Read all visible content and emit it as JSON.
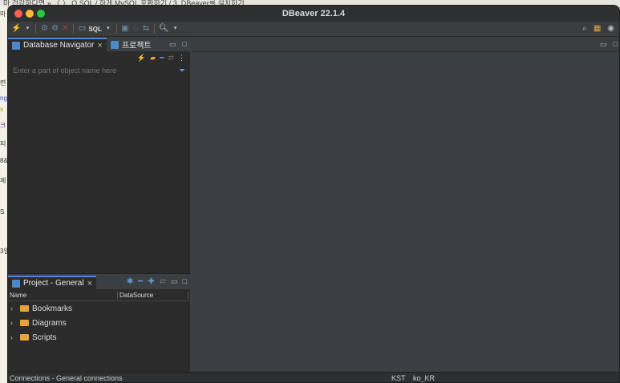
{
  "app": {
    "title": "DBeaver 22.1.4"
  },
  "background": {
    "top_text": "마  건강하다면    »  〈  〉  Q  SQL  /  하게 MySQL 호환하기  /  3. DBeaver를 설치하기",
    "left_chips": [
      "마",
      "련",
      "ng",
      "x",
      "크",
      "되",
      "8&",
      "제",
      "S",
      "3일"
    ]
  },
  "toolbar": {
    "sql_label": "SQL"
  },
  "navigator": {
    "tab_label": "Database Navigator",
    "second_tab_label": "프로젝트",
    "filter_placeholder": "Enter a part of object name here"
  },
  "project": {
    "tab_label": "Project - General",
    "columns": [
      "Name",
      "DataSource"
    ],
    "items": [
      {
        "label": "Bookmarks"
      },
      {
        "label": "Diagrams"
      },
      {
        "label": "Scripts"
      }
    ]
  },
  "status": {
    "connections": "Connections - General connections",
    "timezone": "KST",
    "locale": "ko_KR"
  },
  "colors": {
    "accent": "#4a88c7",
    "folder": "#e8a33d",
    "background": "#3c3f41"
  }
}
